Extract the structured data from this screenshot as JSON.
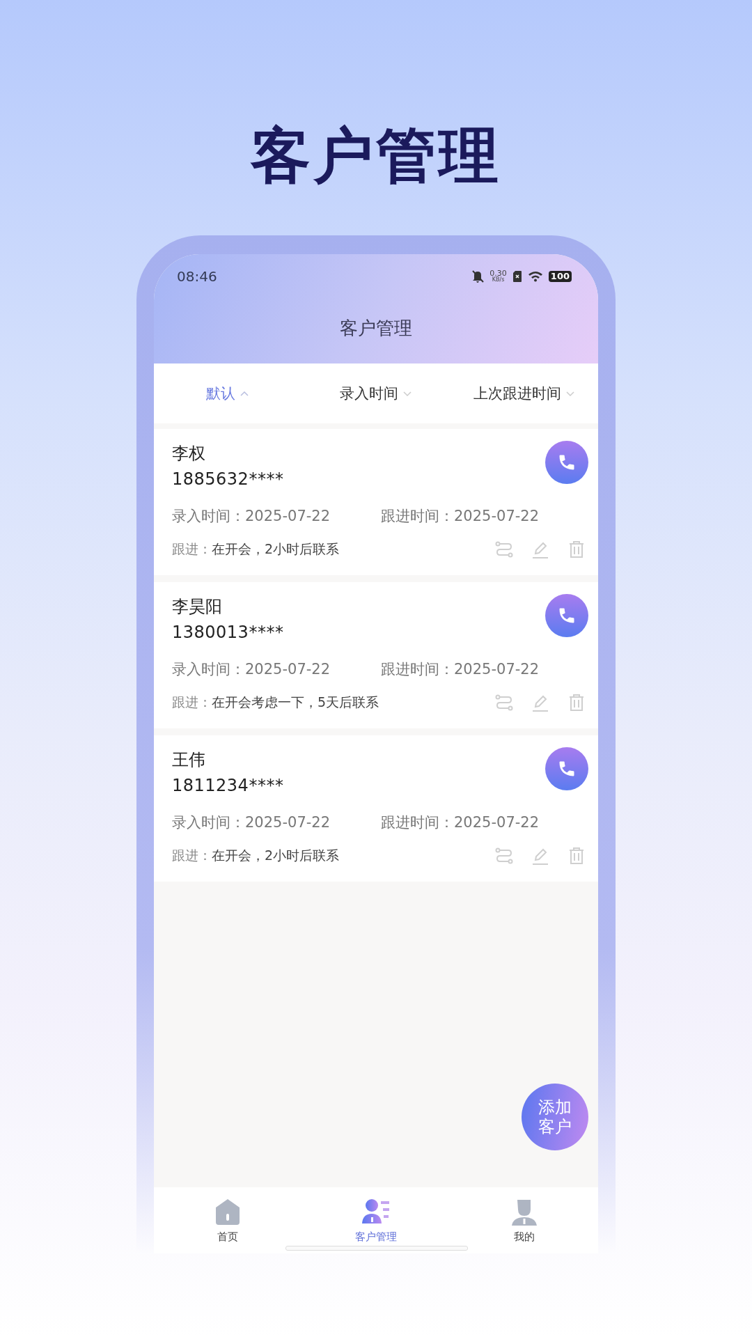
{
  "headline": "客户管理",
  "status_bar": {
    "time": "08:46",
    "speed_value": "0.30",
    "speed_unit": "KB/s",
    "battery": "100"
  },
  "header": {
    "title": "客户管理"
  },
  "sort_tabs": [
    {
      "label": "默认",
      "selected": true
    },
    {
      "label": "录入时间",
      "selected": false
    },
    {
      "label": "上次跟进时间",
      "selected": false
    }
  ],
  "customers": [
    {
      "name": "李权",
      "phone": "1885632****",
      "entry_label": "录入时间：",
      "entry_date": "2025-07-22",
      "follow_label": "跟进时间：",
      "follow_date": "2025-07-22",
      "note_label": "跟进：",
      "note": "在开会，2小时后联系"
    },
    {
      "name": "李昊阳",
      "phone": "1380013****",
      "entry_label": "录入时间：",
      "entry_date": "2025-07-22",
      "follow_label": "跟进时间：",
      "follow_date": "2025-07-22",
      "note_label": "跟进：",
      "note": "在开会考虑一下，5天后联系"
    },
    {
      "name": "王伟",
      "phone": "1811234****",
      "entry_label": "录入时间：",
      "entry_date": "2025-07-22",
      "follow_label": "跟进时间：",
      "follow_date": "2025-07-22",
      "note_label": "跟进：",
      "note": "在开会，2小时后联系"
    }
  ],
  "add_button": "添加客户",
  "nav": [
    {
      "kind": "home",
      "label": "首页",
      "selected": false
    },
    {
      "kind": "customers",
      "label": "客户管理",
      "selected": true
    },
    {
      "kind": "profile",
      "label": "我的",
      "selected": false
    }
  ]
}
